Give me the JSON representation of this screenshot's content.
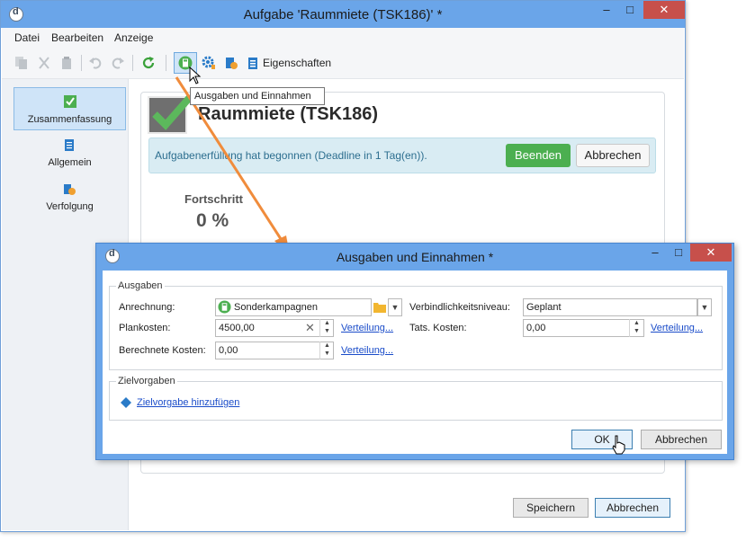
{
  "main_window": {
    "title": "Aufgabe 'Raummiete (TSK186)' *",
    "menu": [
      "Datei",
      "Bearbeiten",
      "Anzeige"
    ],
    "toolbar": {
      "properties_label": "Eigenschaften"
    },
    "tooltip": "Ausgaben und Einnahmen",
    "sidebar": [
      {
        "label": "Zusammenfassung",
        "icon": "checklist-icon"
      },
      {
        "label": "Allgemein",
        "icon": "clipboard-icon"
      },
      {
        "label": "Verfolgung",
        "icon": "tracking-icon"
      }
    ],
    "task_title": "Raummiete (TSK186)",
    "info_text": "Aufgabenerfüllung hat begonnen (Deadline in 1 Tag(en)).",
    "finish_label": "Beenden",
    "cancel_info_label": "Abbrechen",
    "progress_label": "Fortschritt",
    "progress_value": "0 %",
    "save_label": "Speichern",
    "cancel_label": "Abbrechen"
  },
  "dialog": {
    "title": "Ausgaben und Einnahmen *",
    "expenses_group": "Ausgaben",
    "charge_label": "Anrechnung:",
    "charge_value": "Sonderkampagnen",
    "commitment_label": "Verbindlichkeitsniveau:",
    "commitment_value": "Geplant",
    "planned_cost_label": "Plankosten:",
    "planned_cost_value": "4500,00",
    "actual_cost_label": "Tats. Kosten:",
    "actual_cost_value": "0,00",
    "calc_cost_label": "Berechnete Kosten:",
    "calc_cost_value": "0,00",
    "distribution_link": "Verteilung...",
    "targets_group": "Zielvorgaben",
    "add_target_link": "Zielvorgabe hinzufügen",
    "ok_label": "OK",
    "cancel_label": "Abbrechen"
  },
  "colors": {
    "titlebar": "#6aa5e9",
    "close_button": "#c7504b",
    "finish_button": "#4caf50",
    "info_bg": "#d9ecf3",
    "info_text": "#2c6e8f",
    "arrow": "#f08c3c",
    "link": "#1a4cc9"
  }
}
